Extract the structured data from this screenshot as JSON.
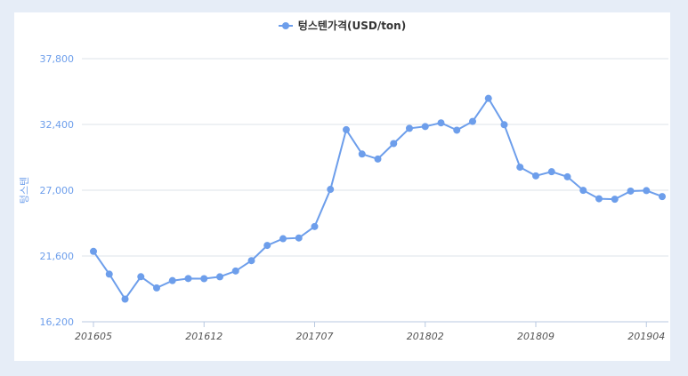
{
  "chart_data": {
    "type": "line",
    "title": "",
    "xlabel": "",
    "ylabel": "텅스텐",
    "ylim": [
      16200,
      37800
    ],
    "yticks": [
      "16,200",
      "21,600",
      "27,000",
      "32,400",
      "37,800"
    ],
    "ytick_values": [
      16200,
      21600,
      27000,
      32400,
      37800
    ],
    "xtick_labels": [
      "201605",
      "201612",
      "201707",
      "201802",
      "201809",
      "201904"
    ],
    "xtick_index": [
      0,
      7,
      14,
      21,
      28,
      35
    ],
    "legend_position": "top-center",
    "grid": true,
    "series": [
      {
        "name": "텅스텐가격(USD/ton)",
        "color": "#6d9eeb",
        "values": [
          21980,
          20110,
          18060,
          19900,
          18980,
          19580,
          19750,
          19740,
          19890,
          20370,
          21220,
          22470,
          23020,
          23080,
          24020,
          27070,
          31970,
          29970,
          29560,
          30830,
          32080,
          32230,
          32530,
          31930,
          32650,
          34540,
          32380,
          28890,
          28180,
          28520,
          28100,
          26990,
          26300,
          26260,
          26930,
          26970,
          26480
        ]
      }
    ]
  }
}
